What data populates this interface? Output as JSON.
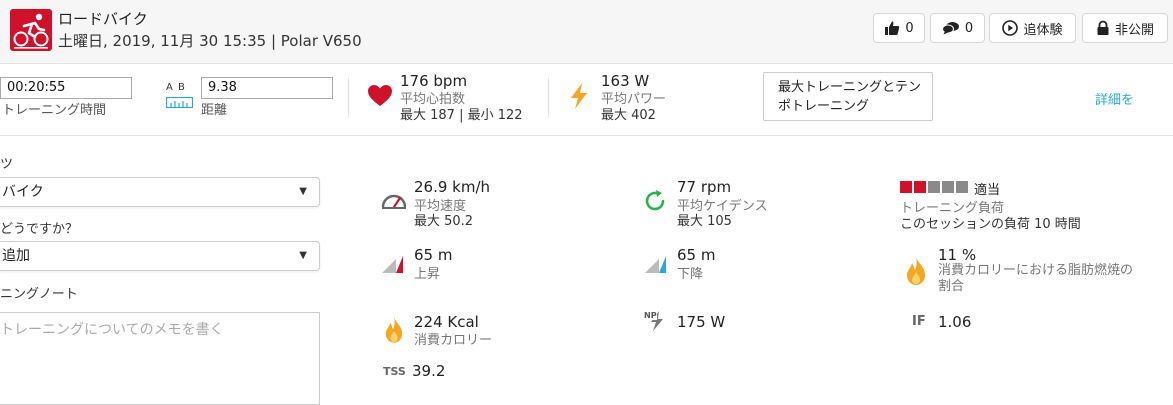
{
  "header": {
    "sport": "ロードバイク",
    "subtitle": "土曜日, 2019, 11月 30 15:35 | Polar V650",
    "like_count": "0",
    "comment_count": "0",
    "experience_label": "追体験",
    "privacy_label": "非公開"
  },
  "summary": {
    "duration_value": "00:20:55",
    "duration_label": "トレーニング時間",
    "distance_ab": "A B",
    "distance_value": "9.38",
    "distance_label": "距離",
    "hr_value": "176 bpm",
    "hr_label": "平均心拍数",
    "hr_sub": "最大 187 | 最小 122",
    "power_value": "163 W",
    "power_label": "平均パワー",
    "power_sub": "最大 402",
    "training_button": "最大トレーニングとテンポトレーニング",
    "details_link": "詳細を"
  },
  "form": {
    "sport_label_fragment": "ツ",
    "sport_value": "バイク",
    "feeling_label": "どうですか？",
    "feeling_value": "追加",
    "note_label": "ニングノート",
    "note_placeholder": "トレーニングについてのメモを書く"
  },
  "metrics": {
    "speed_value": "26.9 km/h",
    "speed_label": "平均速度",
    "speed_sub": "最大 50.2",
    "cadence_value": "77 rpm",
    "cadence_label": "平均ケイデンス",
    "cadence_sub": "最大 105",
    "load_word": "適当",
    "load_label": "トレーニング負荷",
    "load_sub": "このセッションの負荷 10 時間",
    "load_level": 2,
    "load_total": 5,
    "ascent_value": "65 m",
    "ascent_label": "上昇",
    "descent_value": "65 m",
    "descent_label": "下降",
    "fat_value": "11 %",
    "fat_label": "消費カロリーにおける脂肪燃焼の割合",
    "calories_value": "224 Kcal",
    "calories_label": "消費カロリー",
    "np_badge": "NP",
    "np_value": "175 W",
    "if_badge": "IF",
    "if_value": "1.06",
    "tss_badge": "TSS",
    "tss_value": "39.2"
  },
  "colors": {
    "brand_red": "#d0112b",
    "flame": "#f5a623",
    "cadence_green": "#2bb24c",
    "link_blue": "#2aa7d9",
    "load_gray": "#8a8a8a"
  }
}
